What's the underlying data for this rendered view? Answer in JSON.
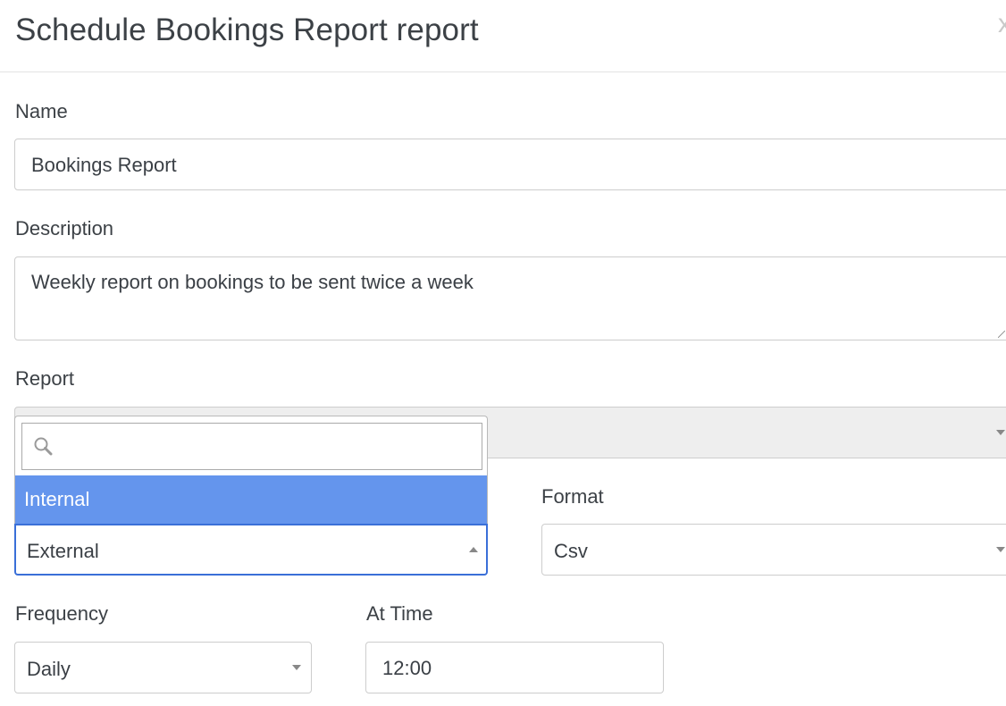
{
  "header": {
    "title": "Schedule Bookings Report report",
    "close_glyph": "x"
  },
  "form": {
    "name": {
      "label": "Name",
      "value": "Bookings Report"
    },
    "description": {
      "label": "Description",
      "value": "Weekly report on bookings to be sent twice a week"
    },
    "report": {
      "label": "Report",
      "value": ""
    },
    "type_dropdown": {
      "search_placeholder": "",
      "options": [
        "Internal"
      ],
      "highlighted": "Internal",
      "selected": "External"
    },
    "format": {
      "label": "Format",
      "value": "Csv"
    },
    "frequency": {
      "label": "Frequency",
      "value": "Daily"
    },
    "at_time": {
      "label": "At Time",
      "value": "12:00"
    }
  },
  "colors": {
    "highlight": "#6495ed",
    "focus_border": "#3a6fd8",
    "disabled_bg": "#eeeeee"
  },
  "icons": {
    "search": "search-icon",
    "caret": "caret-down-icon",
    "close": "close-icon"
  }
}
